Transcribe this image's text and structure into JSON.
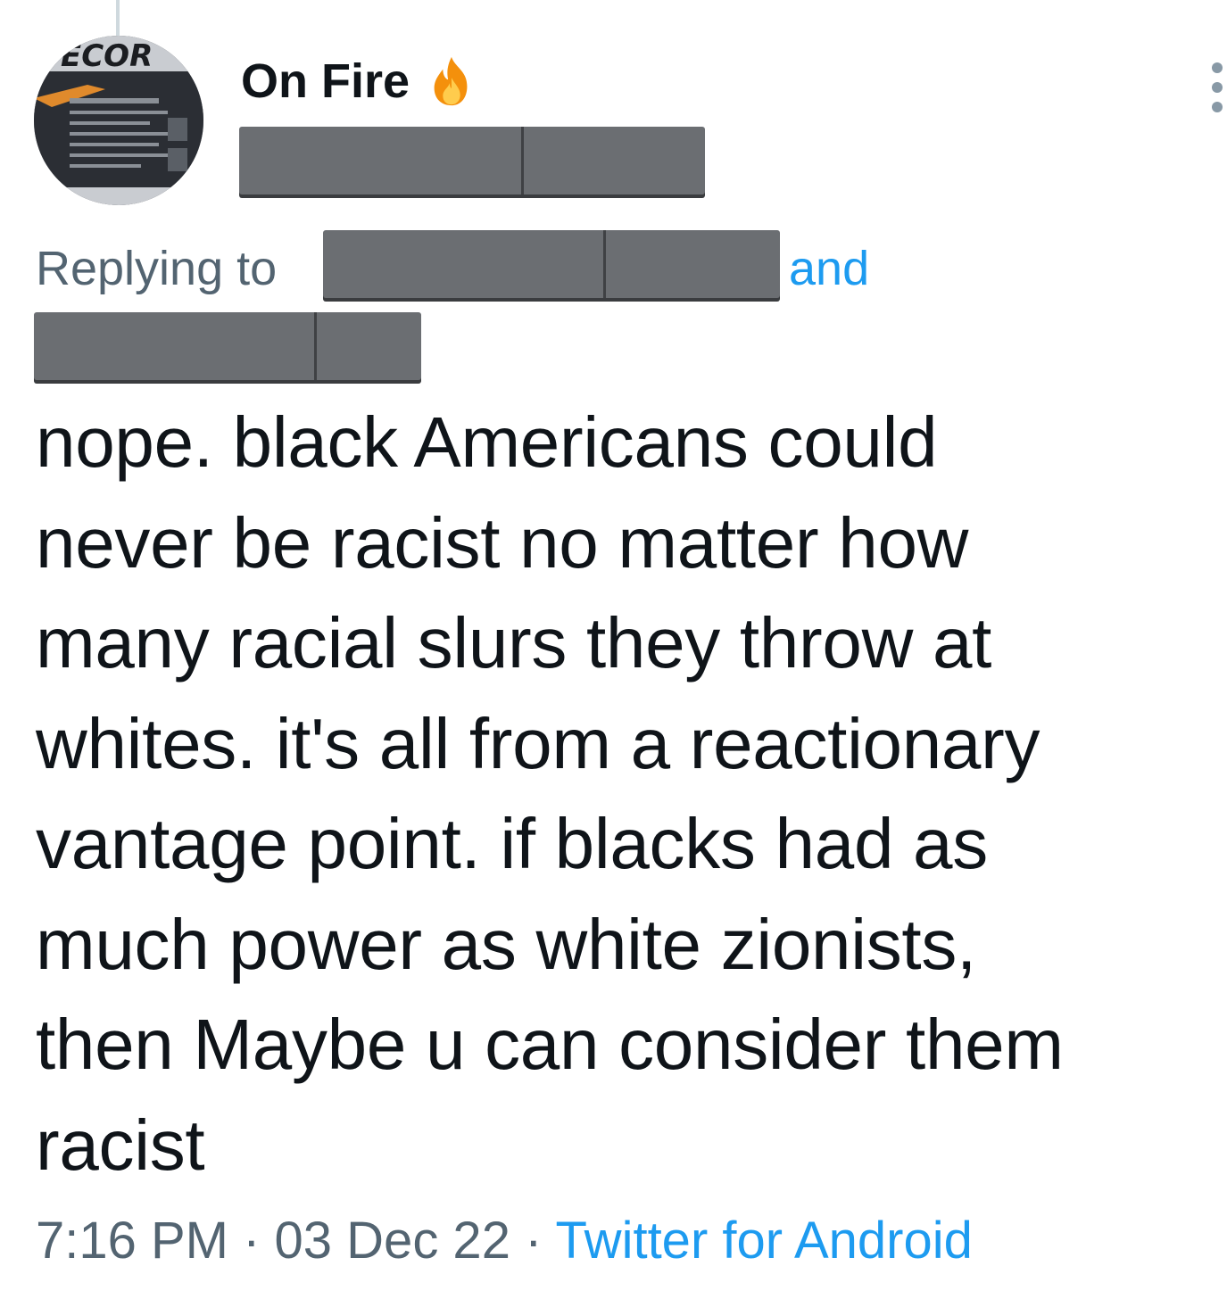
{
  "author": {
    "display_name": "On Fire",
    "display_name_emoji": "fire-emoji",
    "avatar_text": "ECOR",
    "handle": ""
  },
  "reply": {
    "prefix": "Replying to",
    "conjunction": "and"
  },
  "tweet": {
    "lines": [
      "nope. black Americans could",
      "never be racist no matter how",
      "many racial slurs they throw at",
      "whites. it's all from a reactionary",
      "vantage point. if blacks had as",
      "much power as white zionists,",
      "then Maybe u can consider them",
      "racist"
    ]
  },
  "meta": {
    "time": "7:16 PM",
    "separator": " · ",
    "date": "03 Dec 22",
    "source": "Twitter for Android"
  },
  "colors": {
    "text": "#0f1419",
    "secondary": "#536471",
    "link": "#1d9bf0",
    "redaction": "#6b6e72"
  }
}
